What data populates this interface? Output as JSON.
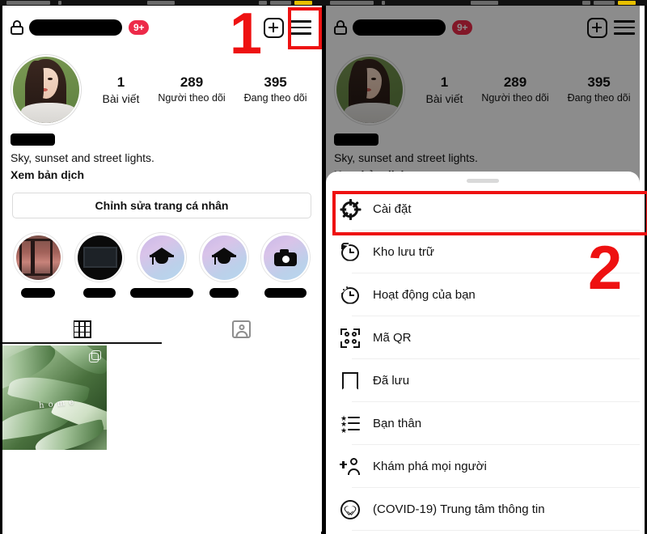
{
  "meta": {
    "app": "Instagram",
    "screen_left": "Profile",
    "screen_right": "Profile with menu sheet open",
    "accent_red": "#ee1111",
    "badge_red": "#ed2a49"
  },
  "profile": {
    "username_redacted": true,
    "lock_icon": "lock-icon",
    "notification_badge": "9+",
    "add_icon": "plus-square-icon",
    "menu_icon": "hamburger-menu-icon",
    "stats": [
      {
        "value": "1",
        "label": "Bài viết"
      },
      {
        "value": "289",
        "label": "Người theo dõi"
      },
      {
        "value": "395",
        "label": "Đang theo dõi"
      }
    ],
    "display_name_redacted": true,
    "bio": "Sky, sunset and street lights.",
    "translate_link": "Xem bản dịch",
    "edit_button": "Chỉnh sửa trang cá nhân",
    "highlights": [
      {
        "icon": "window-photo-icon",
        "label_redacted": true,
        "label_width": 42
      },
      {
        "icon": "dark-room-photo-icon",
        "label_redacted": true,
        "label_width": 40
      },
      {
        "icon": "graduation-cap-icon",
        "label_redacted": true,
        "label_width": 78
      },
      {
        "icon": "graduation-cap-icon",
        "label_redacted": true,
        "label_width": 36
      },
      {
        "icon": "camera-icon",
        "label_redacted": true,
        "label_width": 52
      }
    ],
    "tabs": [
      {
        "icon": "grid-icon",
        "active": true
      },
      {
        "icon": "tagged-person-icon",
        "active": false
      }
    ],
    "posts": [
      {
        "caption_overlay": "h o m e",
        "indicator": "multiple-photos-icon"
      }
    ]
  },
  "sheet": {
    "handle": "drag-handle",
    "items": [
      {
        "icon": "settings-gear-icon",
        "label": "Cài đặt"
      },
      {
        "icon": "archive-clock-icon",
        "label": "Kho lưu trữ"
      },
      {
        "icon": "activity-clock-icon",
        "label": "Hoạt động của bạn"
      },
      {
        "icon": "qr-code-icon",
        "label": "Mã QR"
      },
      {
        "icon": "bookmark-icon",
        "label": "Đã lưu"
      },
      {
        "icon": "close-friends-icon",
        "label": "Bạn thân"
      },
      {
        "icon": "discover-people-icon",
        "label": "Khám phá mọi người"
      },
      {
        "icon": "covid-info-icon",
        "label": "(COVID-19) Trung tâm thông tin"
      }
    ]
  },
  "annotations": {
    "step_one": "1",
    "step_two": "2"
  }
}
